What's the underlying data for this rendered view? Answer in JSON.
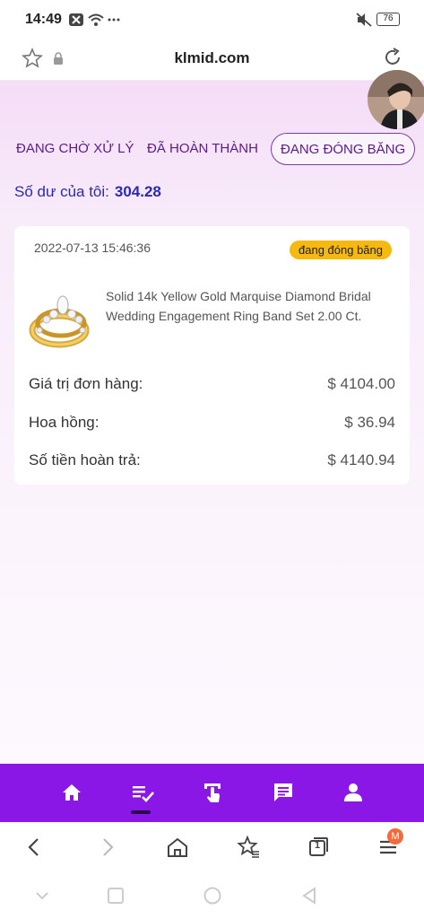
{
  "status_bar": {
    "time": "14:49",
    "battery": "76"
  },
  "browser": {
    "url": "klmid.com"
  },
  "tabs": [
    {
      "label": "ĐANG CHỜ XỬ LÝ"
    },
    {
      "label": "ĐÃ HOÀN THÀNH"
    },
    {
      "label": "ĐANG ĐÓNG BĂNG",
      "active": true
    }
  ],
  "balance": {
    "label": "Số dư của tôi:",
    "value": "304.28"
  },
  "order": {
    "date": "2022-07-13 15:46:36",
    "status": "đang đóng băng",
    "product_title": "Solid 14k Yellow Gold Marquise Diamond Bridal Wedding Engagement Ring Band Set 2.00 Ct.",
    "rows": [
      {
        "label": "Giá trị đơn hàng:",
        "amount": "$ 4104.00"
      },
      {
        "label": "Hoa hồng:",
        "amount": "$ 36.94"
      },
      {
        "label": "Số tiền hoàn trả:",
        "amount": "$ 4140.94"
      }
    ]
  },
  "app_nav": {
    "items": [
      "home-icon",
      "orders-icon",
      "touch-icon",
      "chat-icon",
      "profile-icon"
    ],
    "active_index": 1
  },
  "browser_toolbar": {
    "tab_count": "1",
    "menu_badge": "M"
  },
  "colors": {
    "accent_purple": "#8a17e6",
    "balance_blue": "#2a2ab3",
    "status_yellow": "#f5b90f",
    "tab_text": "#5b1a8a"
  }
}
